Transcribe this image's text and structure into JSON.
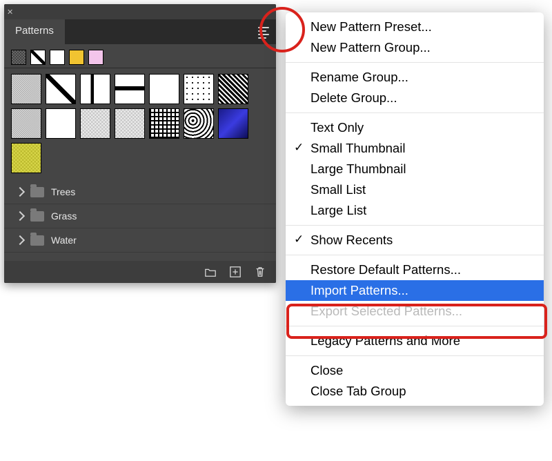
{
  "panel": {
    "title": "Patterns",
    "folders": [
      "Trees",
      "Grass",
      "Water"
    ]
  },
  "menu": {
    "items": [
      {
        "label": "New Pattern Preset...",
        "kind": "item"
      },
      {
        "label": "New Pattern Group...",
        "kind": "item"
      },
      {
        "kind": "sep"
      },
      {
        "label": "Rename Group...",
        "kind": "item"
      },
      {
        "label": "Delete Group...",
        "kind": "item"
      },
      {
        "kind": "sep"
      },
      {
        "label": "Text Only",
        "kind": "item"
      },
      {
        "label": "Small Thumbnail",
        "kind": "item",
        "checked": true
      },
      {
        "label": "Large Thumbnail",
        "kind": "item"
      },
      {
        "label": "Small List",
        "kind": "item"
      },
      {
        "label": "Large List",
        "kind": "item"
      },
      {
        "kind": "sep"
      },
      {
        "label": "Show Recents",
        "kind": "item",
        "checked": true
      },
      {
        "kind": "sep"
      },
      {
        "label": "Restore Default Patterns...",
        "kind": "item"
      },
      {
        "label": "Import Patterns...",
        "kind": "item",
        "selected": true
      },
      {
        "label": "Export Selected Patterns...",
        "kind": "item",
        "disabled": true
      },
      {
        "kind": "sep"
      },
      {
        "label": "Legacy Patterns and More",
        "kind": "item"
      },
      {
        "kind": "sep"
      },
      {
        "label": "Close",
        "kind": "item"
      },
      {
        "label": "Close Tab Group",
        "kind": "item"
      }
    ]
  }
}
